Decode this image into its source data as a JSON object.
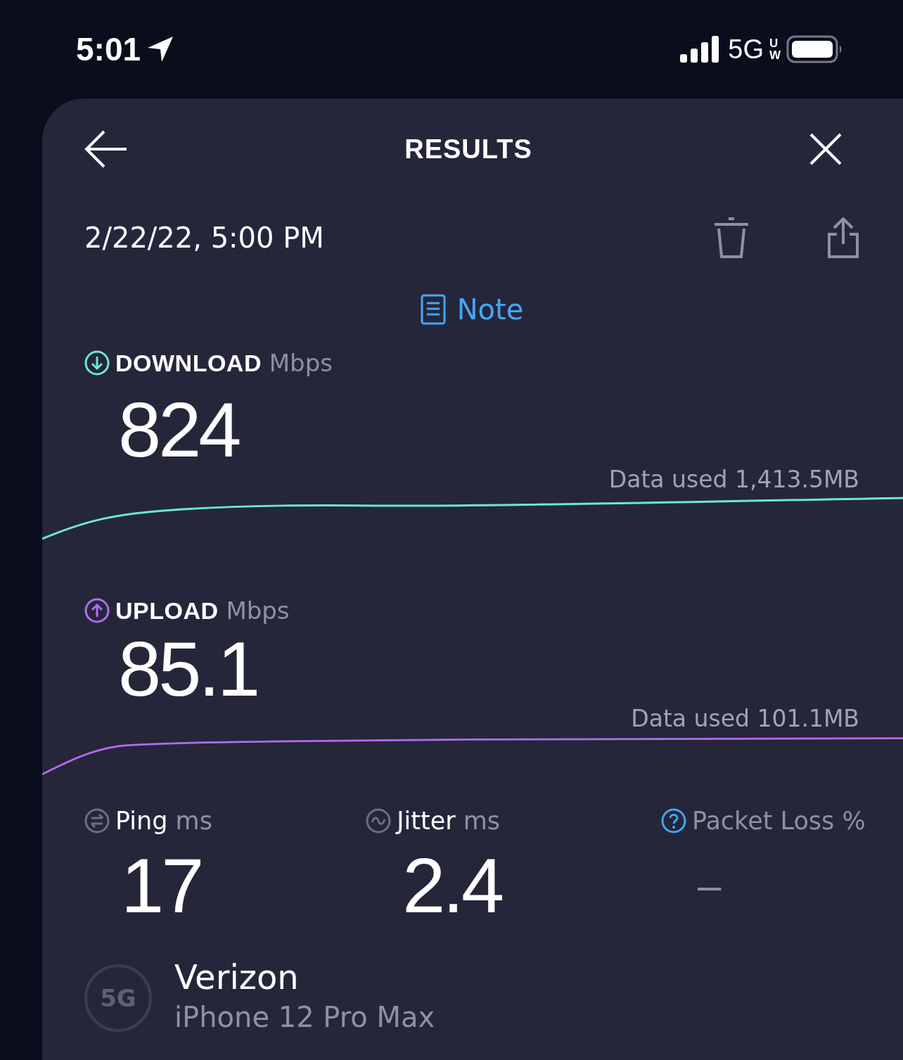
{
  "status_bar": {
    "time": "5:01",
    "network": "5G",
    "network_top": "U",
    "network_bottom": "W"
  },
  "header": {
    "title": "RESULTS"
  },
  "date": "2/22/22, 5:00 PM",
  "note_link": "Note",
  "speeds": [
    {
      "kind": "download",
      "label": "DOWNLOAD",
      "unit": "Mbps",
      "value": "824",
      "data_used": "Data used 1,413.5MB",
      "color": "#6ee6d6"
    },
    {
      "kind": "upload",
      "label": "UPLOAD",
      "unit": "Mbps",
      "value": "85.1",
      "data_used": "Data used 101.1MB",
      "color": "#b36cf2"
    }
  ],
  "metrics": [
    {
      "kind": "ping",
      "label": "Ping",
      "unit": "ms",
      "value": "17"
    },
    {
      "kind": "jitter",
      "label": "Jitter",
      "unit": "ms",
      "value": "2.4"
    },
    {
      "kind": "packet_loss",
      "label": "Packet Loss",
      "unit": "%",
      "value": "–"
    }
  ],
  "provider": {
    "badge": "5G",
    "name": "Verizon",
    "device": "iPhone 12 Pro Max"
  }
}
